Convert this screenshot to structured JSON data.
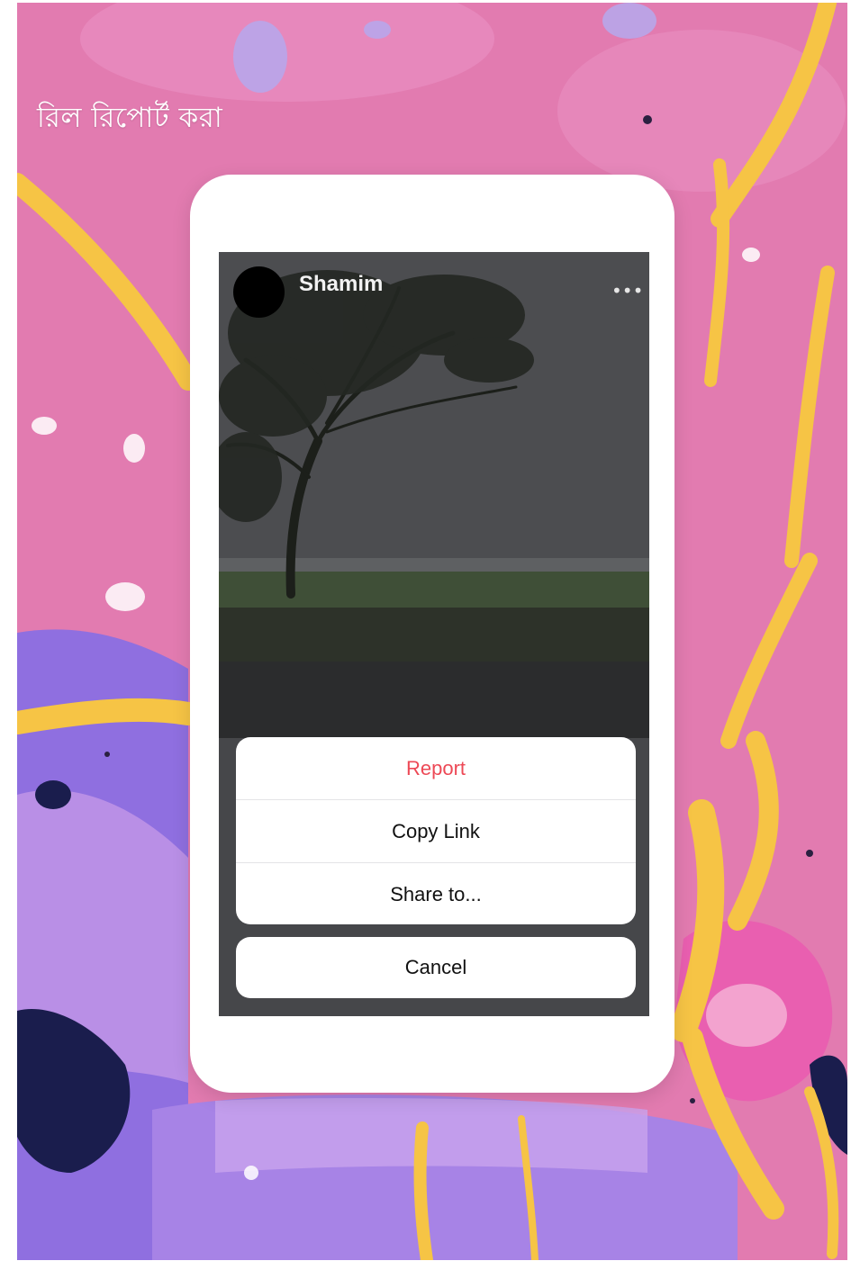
{
  "page": {
    "title": "রিল রিপোর্ট করা"
  },
  "post": {
    "username": "Shamim",
    "more_icon": "more-dots-icon"
  },
  "action_sheet": {
    "items": [
      {
        "label": "Report",
        "style": "destructive",
        "color": "#ed4956"
      },
      {
        "label": "Copy Link",
        "style": "default"
      },
      {
        "label": "Share to...",
        "style": "default"
      }
    ],
    "cancel_label": "Cancel"
  },
  "colors": {
    "background_pink": "#e27bb0",
    "splash_yellow": "#f6c445",
    "splash_purple": "#8c6fd6",
    "phone_frame": "#ffffff"
  }
}
